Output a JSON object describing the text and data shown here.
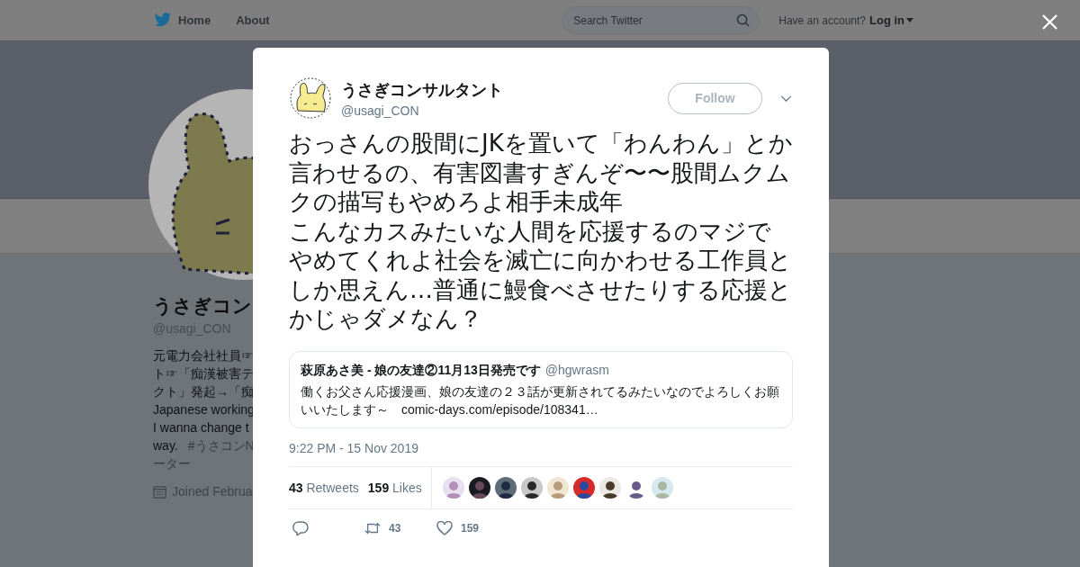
{
  "nav": {
    "links": [
      "Home",
      "About"
    ],
    "search": {
      "placeholder": "Search Twitter"
    },
    "account_prompt": "Have an account?",
    "login": "Log in"
  },
  "profile": {
    "name": "うさぎコン",
    "handle": "@usagi_CON",
    "bio_lines": [
      "元電力会社社員☞",
      "ト☞「痴漢被害テ",
      "クト」発起→「痴",
      "Japanese working",
      "I wanna change t"
    ],
    "bio_last": {
      "text": "way.",
      "tag": "#うさコンN"
    },
    "bio_tail": "ーター",
    "joined": "Joined Februa"
  },
  "tweet": {
    "name": "うさぎコンサルタント",
    "handle": "@usagi_CON",
    "follow": "Follow",
    "text": [
      "おっさんの股間にJKを置いて「わんわん」とか言わせるの、有害図書すぎんぞ〜〜股間ムクムクの描写もやめろよ相手未成年",
      "こんなカスみたいな人間を応援するのマジでやめてくれよ社会を滅亡に向かわせる工作員としか思えん…普通に鰻食べさせたりする応援とかじゃダメなん？"
    ],
    "quote": {
      "name": "萩原あさ美 - 娘の友達②11月13日発売です",
      "handle": "@hgwrasm",
      "text": "働くお父さん応援漫画、娘の友達の２３話が更新されてるみたいなのでよろしくお願いいたします～",
      "link": "comic-days.com/episode/108341…"
    },
    "time": "9:22 PM - 15 Nov 2019",
    "stats": [
      {
        "count": "43",
        "label": "Retweets"
      },
      {
        "count": "159",
        "label": "Likes"
      }
    ],
    "liked_by": [
      {
        "kind": "picture"
      },
      {
        "kind": "picture"
      },
      {
        "kind": "picture"
      },
      {
        "kind": "picture"
      },
      {
        "kind": "picture"
      },
      {
        "kind": "picture"
      },
      {
        "kind": "picture"
      },
      {
        "kind": "picture"
      },
      {
        "kind": "picture"
      }
    ],
    "actions": [
      {
        "kind": "reply"
      },
      {
        "kind": "retweet",
        "count": "43"
      },
      {
        "kind": "like",
        "count": "159"
      }
    ]
  }
}
